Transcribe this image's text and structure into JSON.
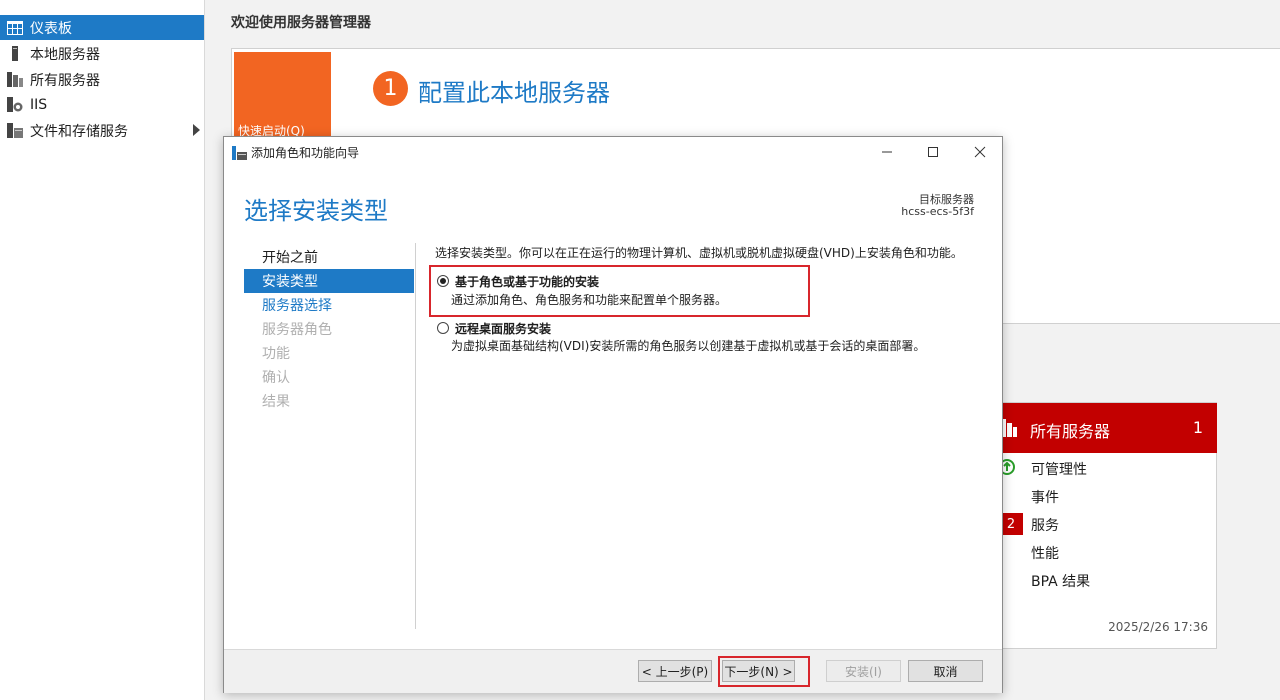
{
  "sidebar": {
    "items": [
      {
        "label": "仪表板",
        "icon": "dashboard-icon",
        "active": true
      },
      {
        "label": "本地服务器",
        "icon": "server-icon"
      },
      {
        "label": "所有服务器",
        "icon": "servers-icon"
      },
      {
        "label": "IIS",
        "icon": "iis-icon"
      },
      {
        "label": "文件和存储服务",
        "icon": "storage-icon",
        "has_submenu": true
      }
    ]
  },
  "main": {
    "title": "欢迎使用服务器管理器",
    "quick_start": "快速启动(Q)",
    "step_number": "1",
    "step_text": "配置此本地服务器"
  },
  "servers_tile": {
    "title": "所有服务器",
    "count": "1",
    "rows": [
      "可管理性",
      "事件",
      "服务",
      "性能",
      "BPA 结果"
    ],
    "services_badge": "2",
    "timestamp": "2025/2/26 17:36"
  },
  "dialog": {
    "title": "添加角色和功能向导",
    "heading": "选择安装类型",
    "target_label": "目标服务器",
    "target_value": "hcss-ecs-5f3f",
    "steps": [
      "开始之前",
      "安装类型",
      "服务器选择",
      "服务器角色",
      "功能",
      "确认",
      "结果"
    ],
    "description": "选择安装类型。你可以在正在运行的物理计算机、虚拟机或脱机虚拟硬盘(VHD)上安装角色和功能。",
    "options": [
      {
        "title": "基于角色或基于功能的安装",
        "desc": "通过添加角色、角色服务和功能来配置单个服务器。",
        "selected": true
      },
      {
        "title": "远程桌面服务安装",
        "desc": "为虚拟桌面基础结构(VDI)安装所需的角色服务以创建基于虚拟机或基于会话的桌面部署。",
        "selected": false
      }
    ],
    "buttons": {
      "prev": "< 上一步(P)",
      "next": "下一步(N) >",
      "install": "安装(I)",
      "cancel": "取消"
    }
  },
  "colors": {
    "accent": "#1e7ac6",
    "orange": "#f26522",
    "red": "#c20000",
    "highlight": "#d8262c"
  }
}
